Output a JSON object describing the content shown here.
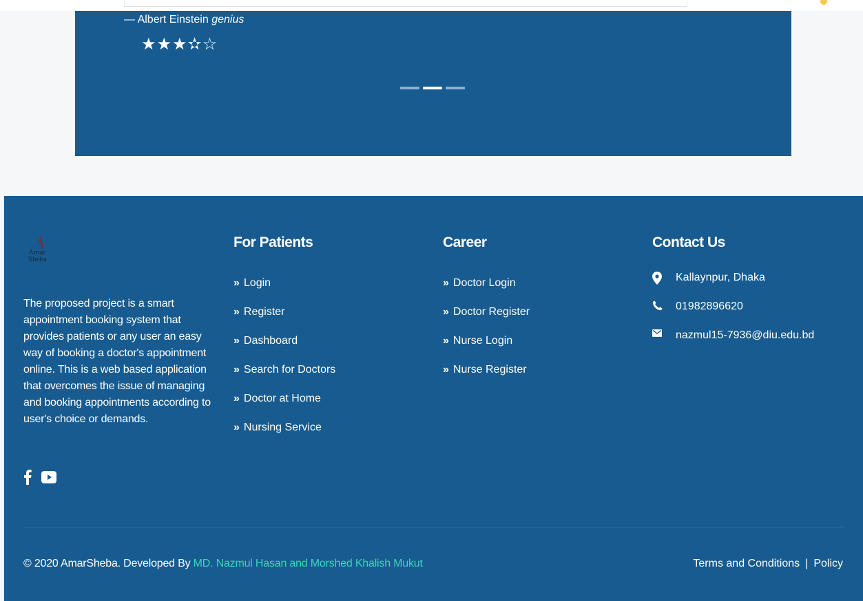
{
  "testimonial": {
    "author_prefix": "— Albert Einstein",
    "author_role": "genius",
    "stars": "★★★✫☆",
    "rating": 3.5,
    "rating_max": 5,
    "slide_count": 3,
    "active_slide": 2
  },
  "footer": {
    "logo_text_line1": "Amar",
    "logo_text_line2": "Sheba",
    "about": "The proposed project is a smart appointment booking system that provides patients or any user an easy way of booking a doctor's appointment online. This is a web based application that overcomes the issue of managing and booking appointments according to user's choice or demands.",
    "patients": {
      "heading": "For Patients",
      "links": [
        "Login",
        "Register",
        "Dashboard",
        "Search for Doctors",
        "Doctor at Home",
        "Nursing Service"
      ]
    },
    "career": {
      "heading": "Career",
      "links": [
        "Doctor Login",
        "Doctor Register",
        "Nurse Login",
        "Nurse Register"
      ]
    },
    "contact": {
      "heading": "Contact Us",
      "address": "Kallaynpur, Dhaka",
      "phone": "01982896620",
      "email": "nazmul15-7936@diu.edu.bd"
    },
    "copyright_prefix": "© 2020 AmarSheba. Developed By ",
    "copyright_authors": "MD. Nazmul Hasan and Morshed Khalish Mukut",
    "terms": "Terms and Conditions",
    "separator": "|",
    "policy": "Policy"
  },
  "colors": {
    "primary": "#175b90",
    "accent": "#3dd6b8",
    "background": "#f6f7f9"
  }
}
